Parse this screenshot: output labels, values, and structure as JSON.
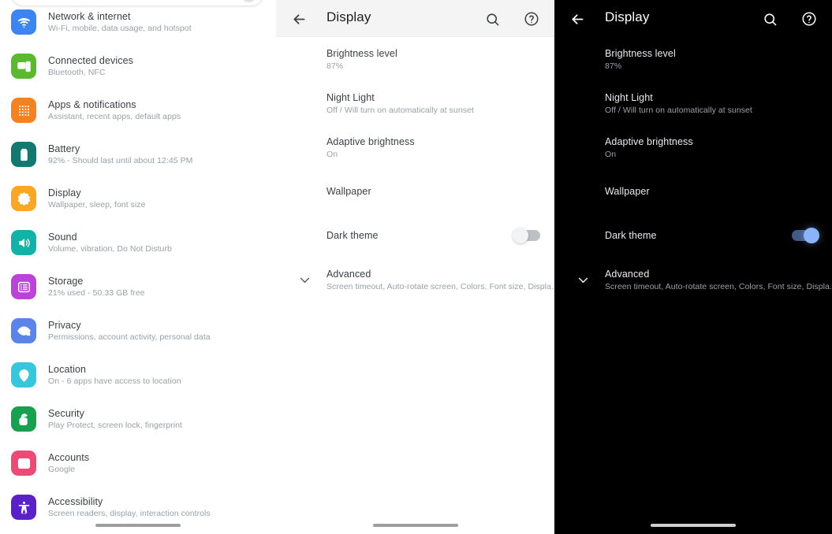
{
  "settings_panel": {
    "search": {
      "placeholder": "",
      "avatar": "account-avatar"
    },
    "items": [
      {
        "icon": "wifi-icon",
        "color": "#3d85f0",
        "title": "Network & internet",
        "subtitle": "Wi-Fi, mobile, data usage, and hotspot"
      },
      {
        "icon": "devices-icon",
        "color": "#5cb831",
        "title": "Connected devices",
        "subtitle": "Bluetooth, NFC"
      },
      {
        "icon": "apps-grid-icon",
        "color": "#f58220",
        "title": "Apps & notifications",
        "subtitle": "Assistant, recent apps, default apps"
      },
      {
        "icon": "battery-icon",
        "color": "#11796f",
        "title": "Battery",
        "subtitle": "92% - Should last until about 12:45 PM"
      },
      {
        "icon": "brightness-icon",
        "color": "#f9a825",
        "title": "Display",
        "subtitle": "Wallpaper, sleep, font size"
      },
      {
        "icon": "volume-icon",
        "color": "#11b3a6",
        "title": "Sound",
        "subtitle": "Volume, vibration, Do Not Disturb"
      },
      {
        "icon": "storage-list-icon",
        "color": "#bb44d8",
        "title": "Storage",
        "subtitle": "21% used - 50.33 GB free"
      },
      {
        "icon": "privacy-eye-icon",
        "color": "#5c83e8",
        "title": "Privacy",
        "subtitle": "Permissions, account activity, personal data"
      },
      {
        "icon": "location-pin-icon",
        "color": "#37c7dd",
        "title": "Location",
        "subtitle": "On - 6 apps have access to location"
      },
      {
        "icon": "unlock-shield-icon",
        "color": "#18a051",
        "title": "Security",
        "subtitle": "Play Protect, screen lock, fingerprint"
      },
      {
        "icon": "account-card-icon",
        "color": "#ec4a77",
        "title": "Accounts",
        "subtitle": "Google"
      },
      {
        "icon": "accessibility-icon",
        "color": "#5b21c9",
        "title": "Accessibility",
        "subtitle": "Screen readers, display, interaction controls"
      }
    ],
    "nav_pill": "gesture-nav-pill"
  },
  "display_light": {
    "appbar": {
      "back": "back-arrow-icon",
      "title": "Display",
      "search": "search-icon",
      "help": "help-circle-icon"
    },
    "rows": [
      {
        "title": "Brightness level",
        "subtitle": "87%",
        "control": "none"
      },
      {
        "title": "Night Light",
        "subtitle": "Off / Will turn on automatically at sunset",
        "control": "none"
      },
      {
        "title": "Adaptive brightness",
        "subtitle": "On",
        "control": "none"
      },
      {
        "title": "Wallpaper",
        "subtitle": "",
        "control": "none"
      },
      {
        "title": "Dark theme",
        "subtitle": "",
        "control": "switch",
        "switch_state": "off"
      },
      {
        "title": "Advanced",
        "subtitle": "Screen timeout, Auto-rotate screen, Colors, Font size, Displa..",
        "control": "chevron",
        "chevron": "chevron-down-icon"
      }
    ],
    "nav_pill": "gesture-nav-pill",
    "theme_label": "light",
    "accent": "#bdc1c6"
  },
  "display_dark": {
    "appbar": {
      "back": "back-arrow-icon",
      "title": "Display",
      "search": "search-icon",
      "help": "help-circle-icon"
    },
    "rows": [
      {
        "title": "Brightness level",
        "subtitle": "87%",
        "control": "none"
      },
      {
        "title": "Night Light",
        "subtitle": "Off / Will turn on automatically at sunset",
        "control": "none"
      },
      {
        "title": "Adaptive brightness",
        "subtitle": "On",
        "control": "none"
      },
      {
        "title": "Wallpaper",
        "subtitle": "",
        "control": "none"
      },
      {
        "title": "Dark theme",
        "subtitle": "",
        "control": "switch",
        "switch_state": "on"
      },
      {
        "title": "Advanced",
        "subtitle": "Screen timeout, Auto-rotate screen, Colors, Font size, Displa..",
        "control": "chevron",
        "chevron": "chevron-down-icon"
      }
    ],
    "nav_pill": "gesture-nav-pill",
    "theme_label": "dark",
    "accent": "#8ab4f8"
  }
}
